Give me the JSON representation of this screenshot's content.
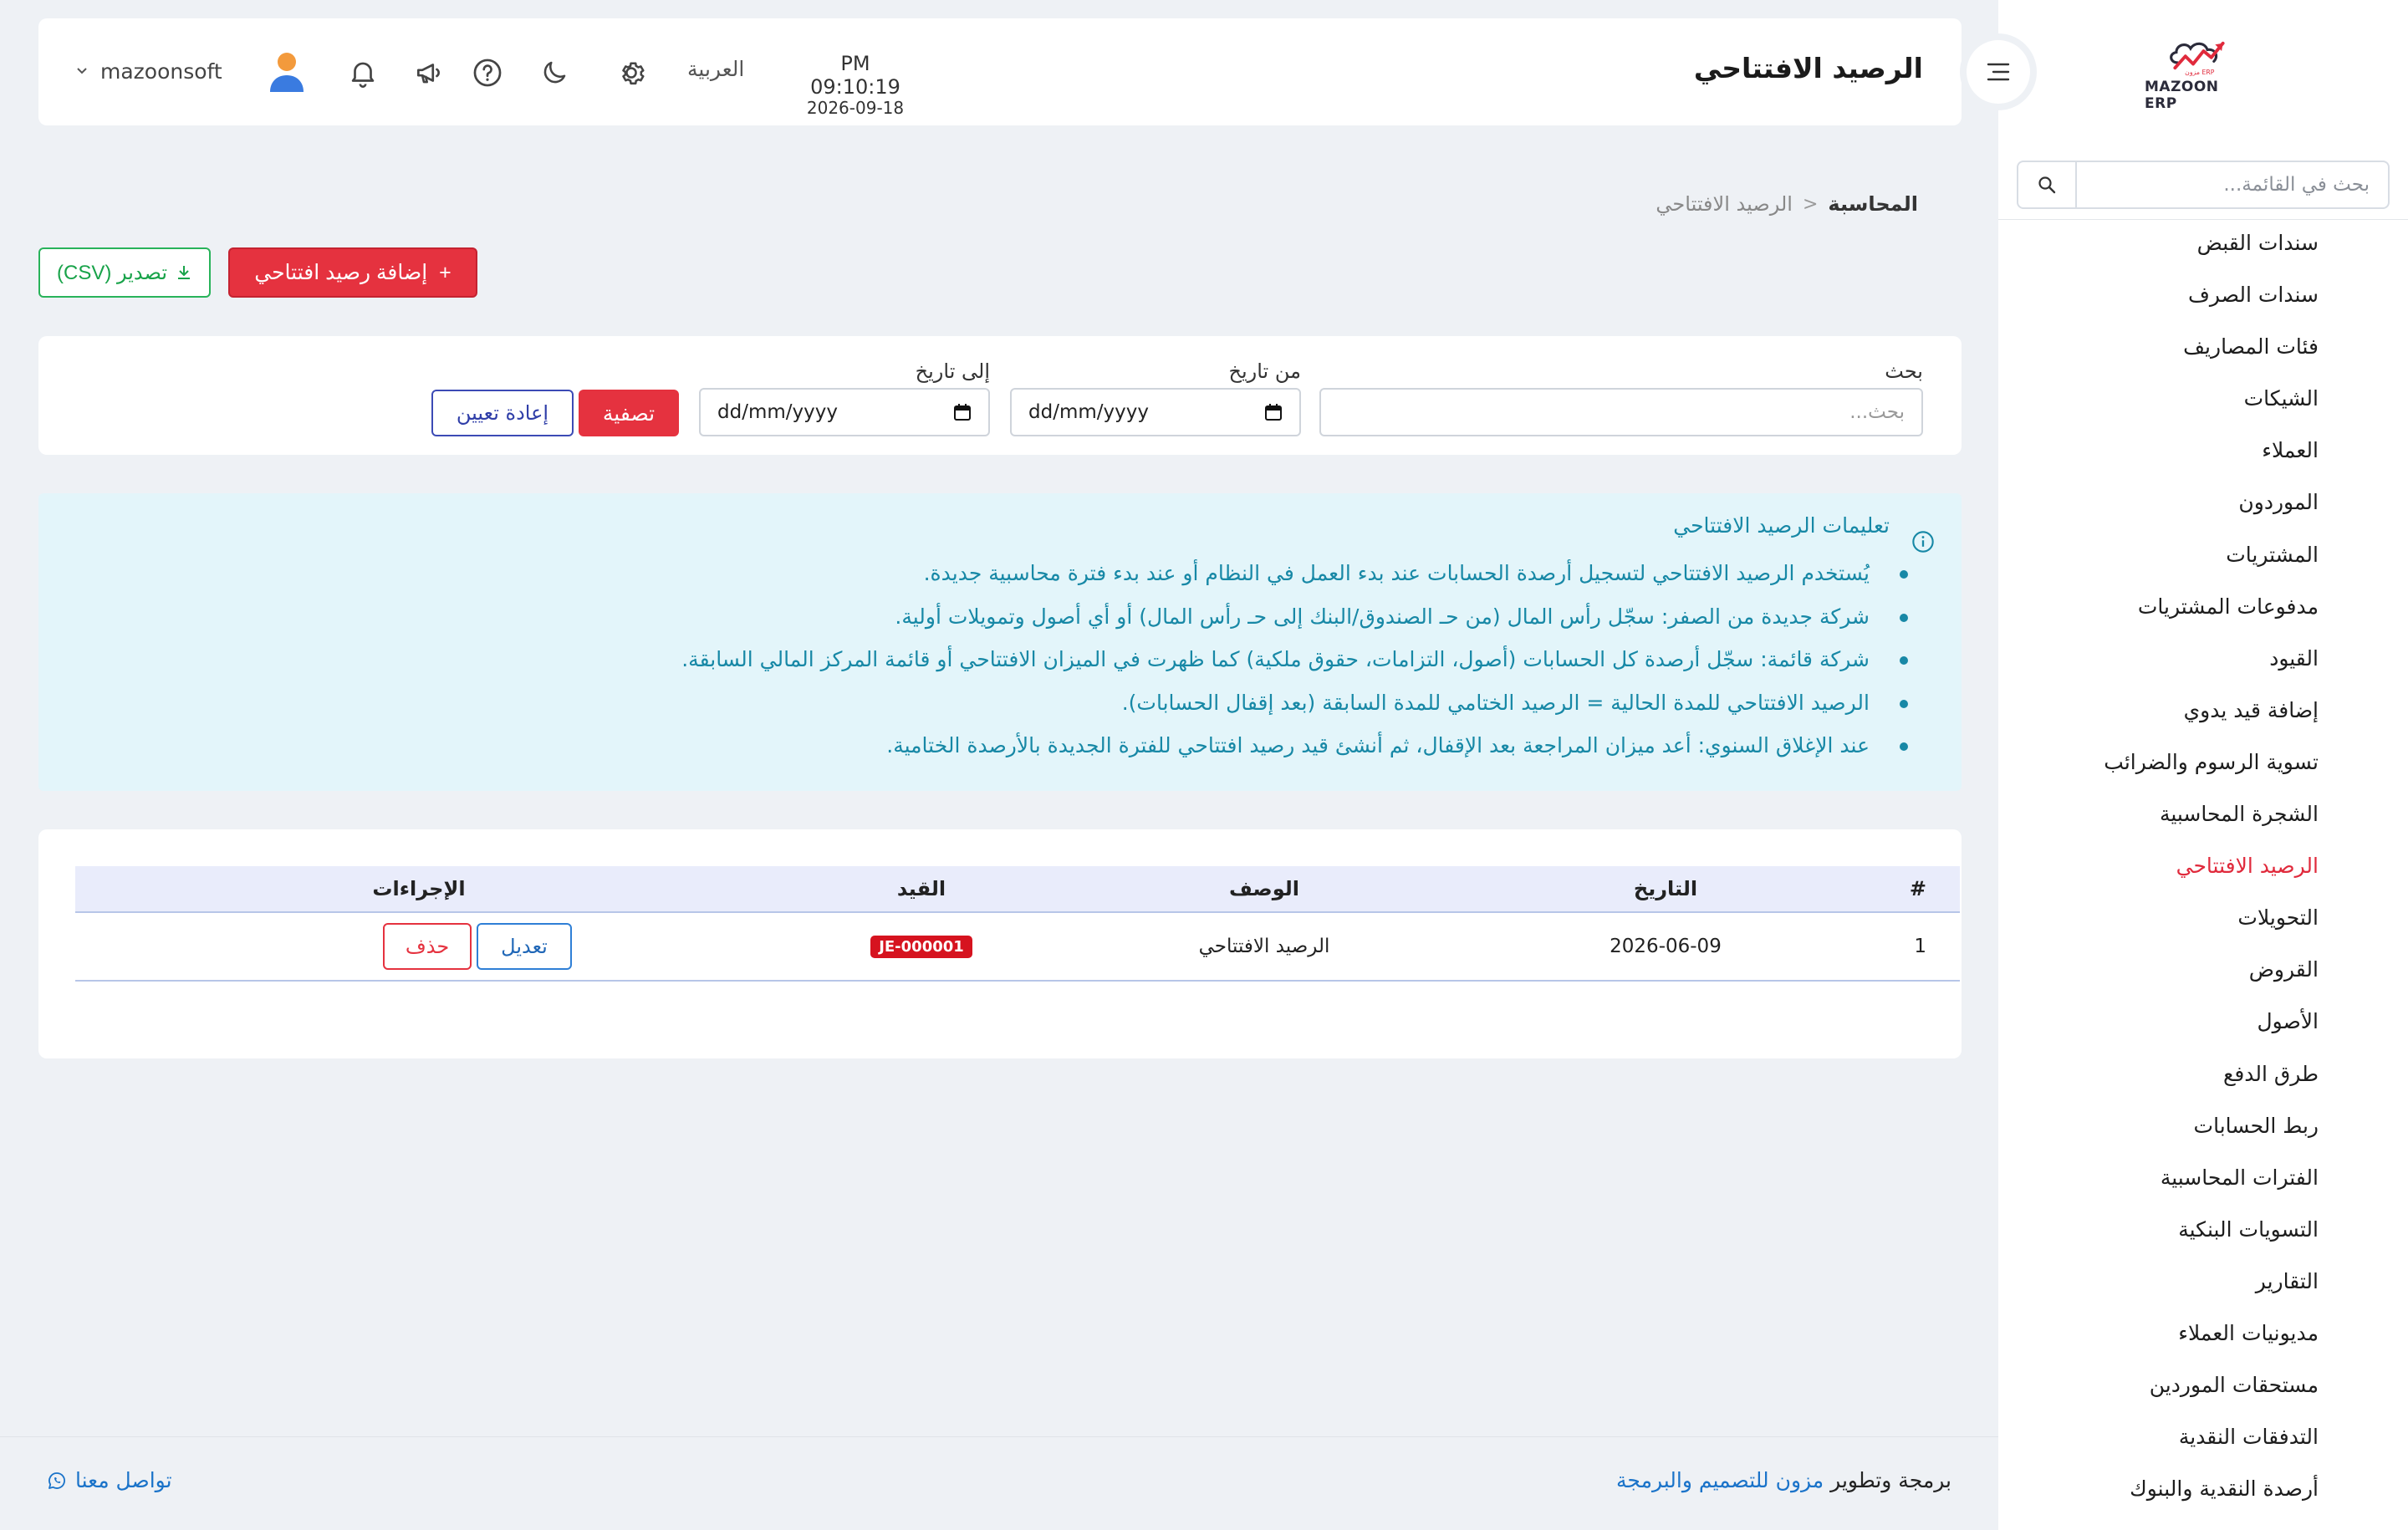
{
  "app": {
    "brand_name": "MAZOON ERP",
    "logo_script": "ERP مزون"
  },
  "sidebar": {
    "search_placeholder": "بحث في القائمة...",
    "items": [
      {
        "label": "سندات القبض"
      },
      {
        "label": "سندات الصرف"
      },
      {
        "label": "فئات المصاريف"
      },
      {
        "label": "الشيكات"
      },
      {
        "label": "العملاء"
      },
      {
        "label": "الموردون"
      },
      {
        "label": "المشتريات"
      },
      {
        "label": "مدفوعات المشتريات"
      },
      {
        "label": "القيود"
      },
      {
        "label": "إضافة قيد يدوي"
      },
      {
        "label": "تسوية الرسوم والضرائب"
      },
      {
        "label": "الشجرة المحاسبية"
      },
      {
        "label": "الرصيد الافتتاحي",
        "active": true
      },
      {
        "label": "التحويلات"
      },
      {
        "label": "القروض"
      },
      {
        "label": "الأصول"
      },
      {
        "label": "طرق الدفع"
      },
      {
        "label": "ربط الحسابات"
      },
      {
        "label": "الفترات المحاسبية"
      },
      {
        "label": "التسويات البنكية"
      },
      {
        "label": "التقارير"
      },
      {
        "label": "مديونيات العملاء"
      },
      {
        "label": "مستحقات الموردين"
      },
      {
        "label": "التدفقات النقدية"
      },
      {
        "label": "أرصدة النقدية والبنوك"
      }
    ]
  },
  "header": {
    "page_title": "الرصيد الافتتاحي",
    "clock_time": "PM 09:10:19",
    "clock_date": "2026-09-18",
    "language": "العربية",
    "username": "mazoonsoft"
  },
  "breadcrumb": {
    "parent": "المحاسبة",
    "separator": "<",
    "current": "الرصيد الافتتاحي"
  },
  "actions": {
    "add_label": "إضافة رصيد افتتاحي",
    "add_icon": "+",
    "export_label": "تصدير (CSV)"
  },
  "filters": {
    "search_label": "بحث",
    "search_placeholder": "بحث...",
    "from_label": "من تاريخ",
    "to_label": "إلى تاريخ",
    "date_placeholder": "dd/mm/yyyy",
    "filter_button": "تصفية",
    "reset_button": "إعادة تعيين"
  },
  "info": {
    "title": "تعليمات الرصيد الافتتاحي",
    "items": [
      "يُستخدم الرصيد الافتتاحي لتسجيل أرصدة الحسابات عند بدء العمل في النظام أو عند بدء فترة محاسبية جديدة.",
      "شركة جديدة من الصفر: سجّل رأس المال (من حـ الصندوق/البنك إلى حـ رأس المال) أو أي أصول وتمويلات أولية.",
      "شركة قائمة: سجّل أرصدة كل الحسابات (أصول، التزامات، حقوق ملكية) كما ظهرت في الميزان الافتتاحي أو قائمة المركز المالي السابقة.",
      "الرصيد الافتتاحي للمدة الحالية = الرصيد الختامي للمدة السابقة (بعد إقفال الحسابات).",
      "عند الإغلاق السنوي: أعد ميزان المراجعة بعد الإقفال، ثم أنشئ قيد رصيد افتتاحي للفترة الجديدة بالأرصدة الختامية."
    ]
  },
  "table": {
    "headers": {
      "num": "#",
      "date": "التاريخ",
      "description": "الوصف",
      "entry": "القيد",
      "actions": "الإجراءات"
    },
    "rows": [
      {
        "num": "1",
        "date": "2026-06-09",
        "description": "الرصيد الافتتاحي",
        "entry": "JE-000001",
        "edit_label": "تعديل",
        "delete_label": "حذف"
      }
    ]
  },
  "footer": {
    "credit_prefix": "برمجة وتطوير",
    "credit_brand": "مزون للتصميم والبرمجة",
    "contact_label": "تواصل معنا"
  },
  "colors": {
    "accent_red": "#e5323f",
    "active_menu": "#e02a3c",
    "export_green": "#28b35a",
    "info_text": "#1788a6",
    "info_bg": "#e3f5fa",
    "link_blue": "#1a73c9"
  }
}
